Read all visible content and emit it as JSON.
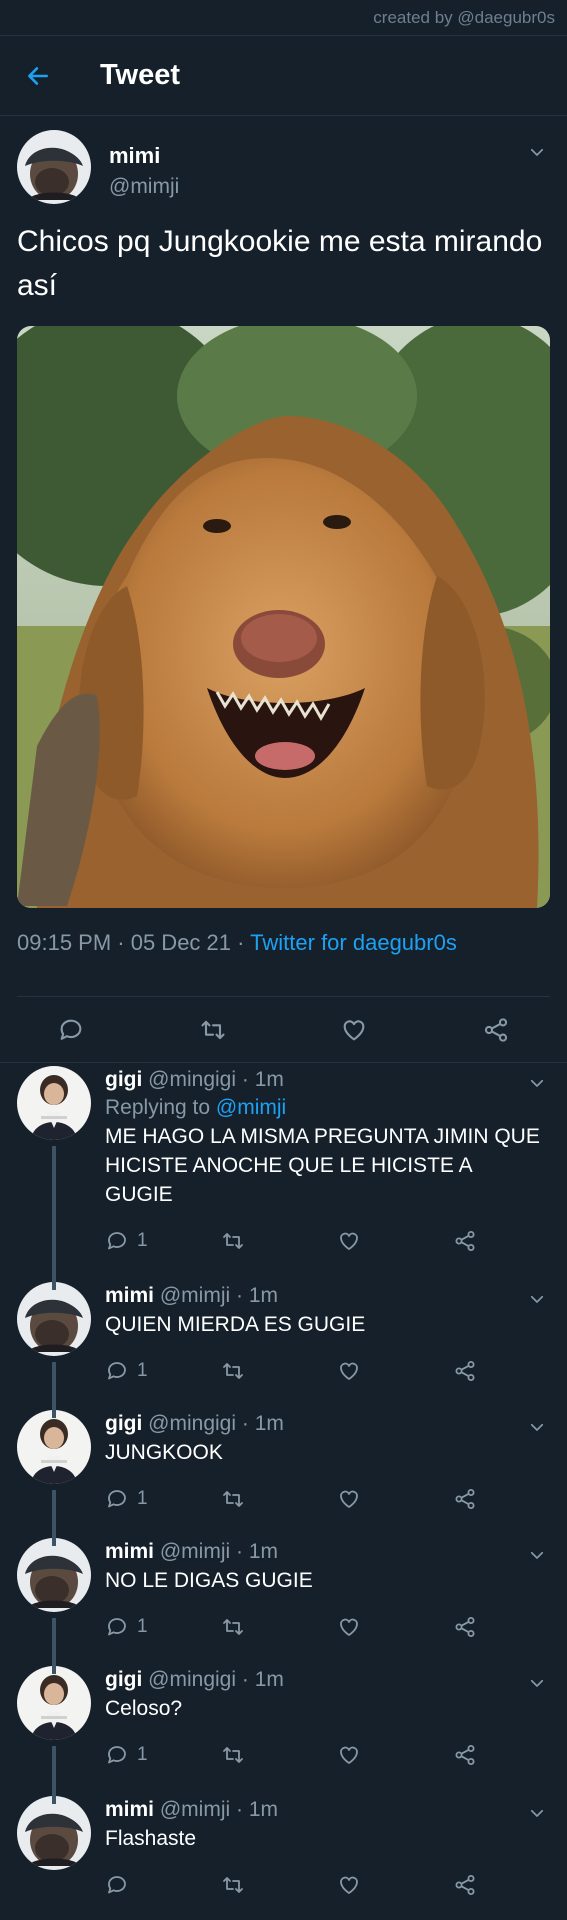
{
  "credit": "created by @daegubr0s",
  "header": {
    "title": "Tweet",
    "back_icon": "arrow-left-icon"
  },
  "tweet": {
    "name": "mimi",
    "handle": "@mimji",
    "text": "Chicos pq Jungkookie me esta mirando así",
    "photo": "golden-retriever-dog-photo",
    "time": "09:15 PM · 05 Dec 21 · ",
    "source": "Twitter for daegubr0s",
    "icons": [
      "reply-icon",
      "retweet-icon",
      "like-icon",
      "share-icon"
    ]
  },
  "replies": [
    {
      "name": "gigi",
      "handle": "@mingigi",
      "time": "· 1m",
      "replying_prefix": "Replying to ",
      "replying_to": "@mimji",
      "text": "ME HAGO LA MISMA PREGUNTA JIMIN QUE HICISTE ANOCHE QUE LE HICISTE A  GUGIE",
      "reply_count": "1"
    },
    {
      "name": "mimi",
      "handle": "@mimji",
      "time": "· 1m",
      "text": "QUIEN MIERDA ES GUGIE",
      "reply_count": "1"
    },
    {
      "name": "gigi",
      "handle": "@mingigi",
      "time": "· 1m",
      "text": "JUNGKOOK",
      "reply_count": "1"
    },
    {
      "name": "mimi",
      "handle": "@mimji",
      "time": "· 1m",
      "text": "NO LE DIGAS GUGIE",
      "reply_count": "1"
    },
    {
      "name": "gigi",
      "handle": "@mingigi",
      "time": "· 1m",
      "text": "Celoso?",
      "reply_count": "1"
    },
    {
      "name": "mimi",
      "handle": "@mimji",
      "time": "· 1m",
      "text": "Flashaste",
      "reply_count": ""
    }
  ],
  "colors": {
    "background": "#15202b",
    "accent": "#1da1f2",
    "muted": "#8899a6",
    "divider": "#253341"
  }
}
